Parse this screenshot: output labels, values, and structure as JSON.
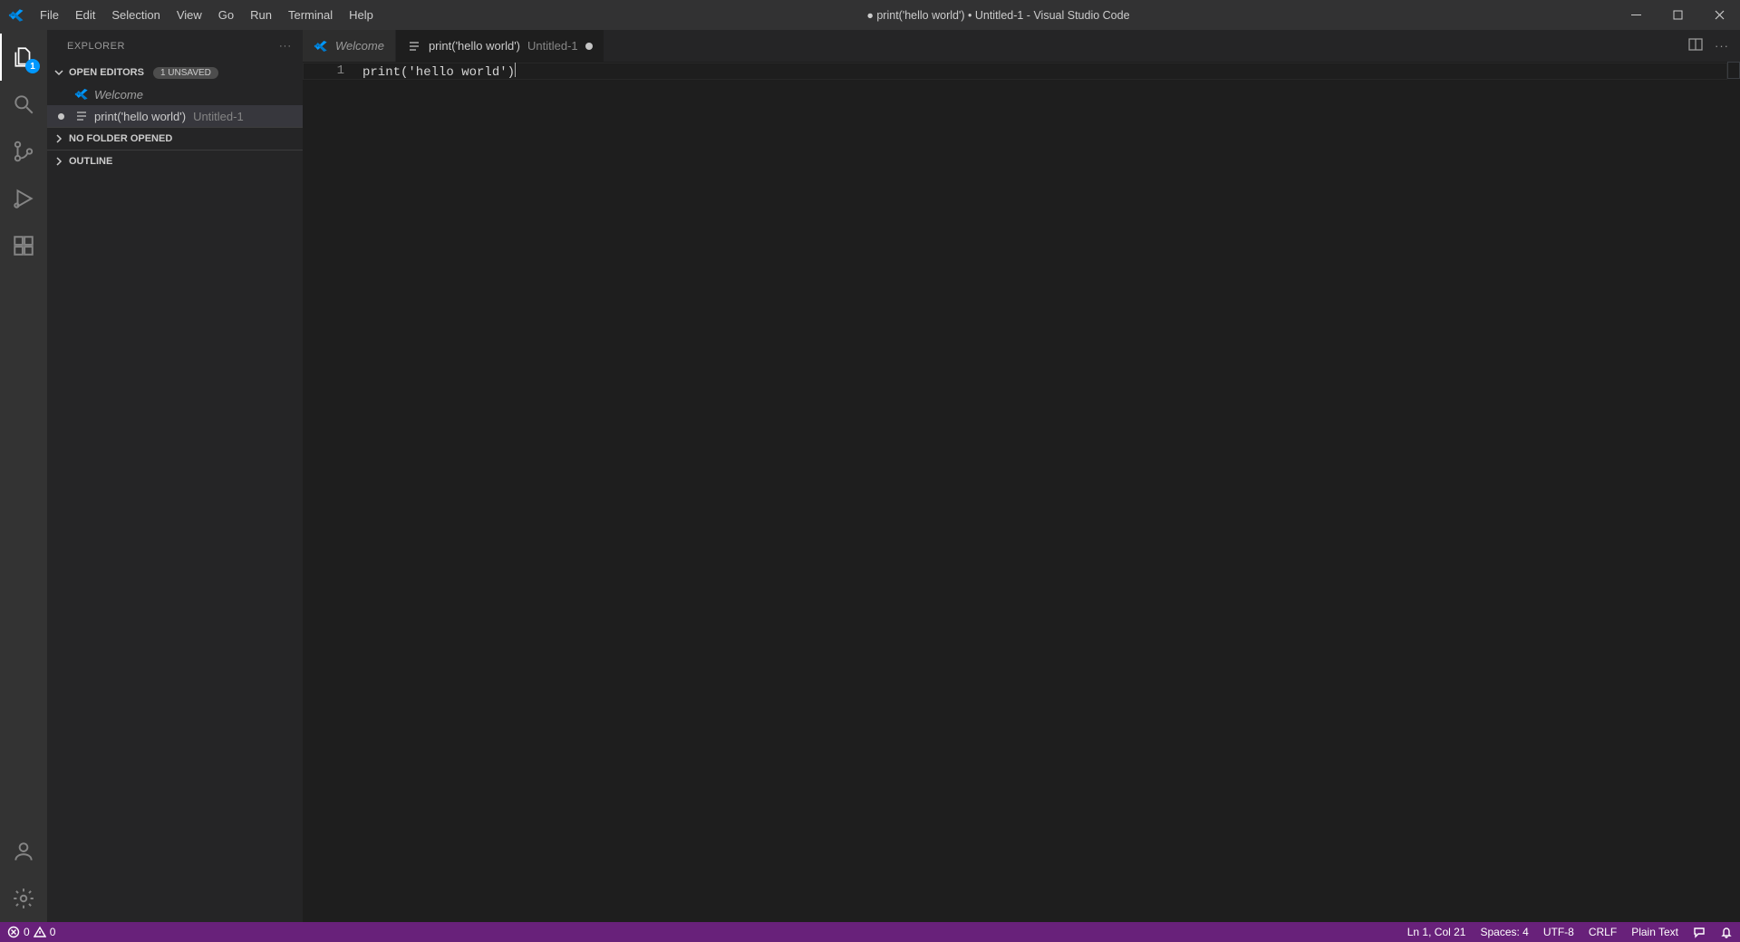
{
  "title": "● print('hello world') • Untitled-1 - Visual Studio Code",
  "menu": [
    "File",
    "Edit",
    "Selection",
    "View",
    "Go",
    "Run",
    "Terminal",
    "Help"
  ],
  "activitybar": {
    "explorer_badge": "1"
  },
  "sidebar": {
    "title": "EXPLORER",
    "open_editors": {
      "label": "OPEN EDITORS",
      "unsaved_badge": "1 UNSAVED",
      "items": [
        {
          "label": "Welcome",
          "sub": "",
          "dirty": false,
          "welcome": true
        },
        {
          "label": "print('hello world')",
          "sub": "Untitled-1",
          "dirty": true,
          "welcome": false
        }
      ]
    },
    "sections": [
      {
        "label": "NO FOLDER OPENED"
      },
      {
        "label": "OUTLINE"
      }
    ]
  },
  "tabs": [
    {
      "label": "Welcome",
      "sub": "",
      "active": false,
      "dirty": false,
      "welcome": true
    },
    {
      "label": "print('hello world')",
      "sub": "Untitled-1",
      "active": true,
      "dirty": true,
      "welcome": false
    }
  ],
  "editor": {
    "line_numbers": [
      "1"
    ],
    "lines": [
      "print('hello world')"
    ]
  },
  "statusbar": {
    "errors": "0",
    "warnings": "0",
    "position": "Ln 1, Col 21",
    "spaces": "Spaces: 4",
    "encoding": "UTF-8",
    "eol": "CRLF",
    "language": "Plain Text"
  }
}
